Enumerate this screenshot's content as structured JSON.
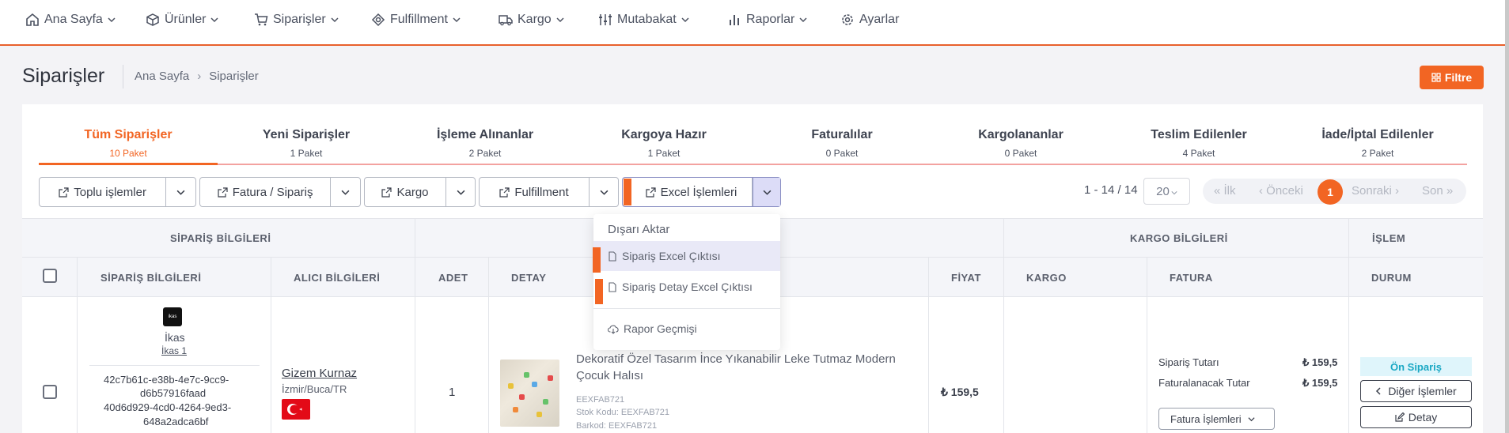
{
  "nav": {
    "items": [
      {
        "label": "Ana Sayfa",
        "icon": "home-icon"
      },
      {
        "label": "Ürünler",
        "icon": "box-icon"
      },
      {
        "label": "Siparişler",
        "icon": "cart-icon"
      },
      {
        "label": "Fulfillment",
        "icon": "gear-box-icon"
      },
      {
        "label": "Kargo",
        "icon": "truck-icon"
      },
      {
        "label": "Mutabakat",
        "icon": "sliders-icon"
      },
      {
        "label": "Raporlar",
        "icon": "bar-chart-icon"
      },
      {
        "label": "Ayarlar",
        "icon": "gear-icon"
      }
    ]
  },
  "header": {
    "title": "Siparişler",
    "breadcrumb": [
      "Ana Sayfa",
      "Siparişler"
    ],
    "filter_label": "Filtre"
  },
  "tabs": [
    {
      "label": "Tüm Siparişler",
      "count": "10 Paket",
      "active": true
    },
    {
      "label": "Yeni Siparişler",
      "count": "1 Paket"
    },
    {
      "label": "İşleme Alınanlar",
      "count": "2 Paket"
    },
    {
      "label": "Kargoya Hazır",
      "count": "1 Paket"
    },
    {
      "label": "Faturalılar",
      "count": "0 Paket"
    },
    {
      "label": "Kargolananlar",
      "count": "0 Paket"
    },
    {
      "label": "Teslim Edilenler",
      "count": "4 Paket"
    },
    {
      "label": "İade/İptal Edilenler",
      "count": "2 Paket"
    }
  ],
  "toolbar": {
    "buttons": [
      "Toplu işlemler",
      "Fatura / Sipariş",
      "Kargo",
      "Fulfillment",
      "Excel İşlemleri"
    ]
  },
  "pagination": {
    "range": "1 - 14 / 14",
    "page_size": "20",
    "first": "« İlk",
    "prev": "‹ Önceki",
    "current": "1",
    "next": "Sonraki ›",
    "last": "Son »"
  },
  "table": {
    "group_headers": {
      "order": "SİPARİŞ BİLGİLERİ",
      "shipping": "KARGO BİLGİLERİ",
      "action": "İŞLEM"
    },
    "columns": {
      "order": "SİPARİŞ BİLGİLERİ",
      "recipient": "ALICI BİLGİLERİ",
      "qty": "ADET",
      "detail": "DETAY",
      "price": "FİYAT",
      "cargo": "KARGO",
      "invoice": "FATURA",
      "status": "DURUM"
    },
    "row": {
      "store_logo": "ikas",
      "store": "İkas",
      "store_link": "İkas 1",
      "order_id_1a": "42c7b61c-e38b-4e7c-9cc9-",
      "order_id_1b": "d6b57916faad",
      "order_id_2a": "40d6d929-4cd0-4264-9ed3-",
      "order_id_2b": "648a2adca6bf",
      "recipient_name": "Gizem Kurnaz",
      "recipient_location": "İzmir/Buca/TR",
      "qty": "1",
      "product_title_1": "Dekoratif Özel Tasarım İnce Yıkanabilir Leke Tutmaz Modern",
      "product_title_2": "Çocuk Halısı",
      "sku": "EEXFAB721",
      "stock_code": "Stok Kodu: EEXFAB721",
      "barcode": "Barkod: EEXFAB721",
      "price": "₺ 159,5",
      "order_total_label": "Sipariş Tutarı",
      "order_total": "₺ 159,5",
      "invoice_total_label": "Faturalanacak Tutar",
      "invoice_total": "₺ 159,5",
      "invoice_ops": "Fatura İşlemleri",
      "status_badge": "Ön Sipariş",
      "other_ops": "Diğer İşlemler",
      "detail_btn": "Detay"
    }
  },
  "excel_menu": {
    "header": "Dışarı Aktar",
    "items": [
      "Sipariş Excel Çıktısı",
      "Sipariş Detay Excel Çıktısı"
    ],
    "history": "Rapor Geçmişi"
  },
  "colors": {
    "accent": "#f26523",
    "badge": "#1aa8c4"
  }
}
